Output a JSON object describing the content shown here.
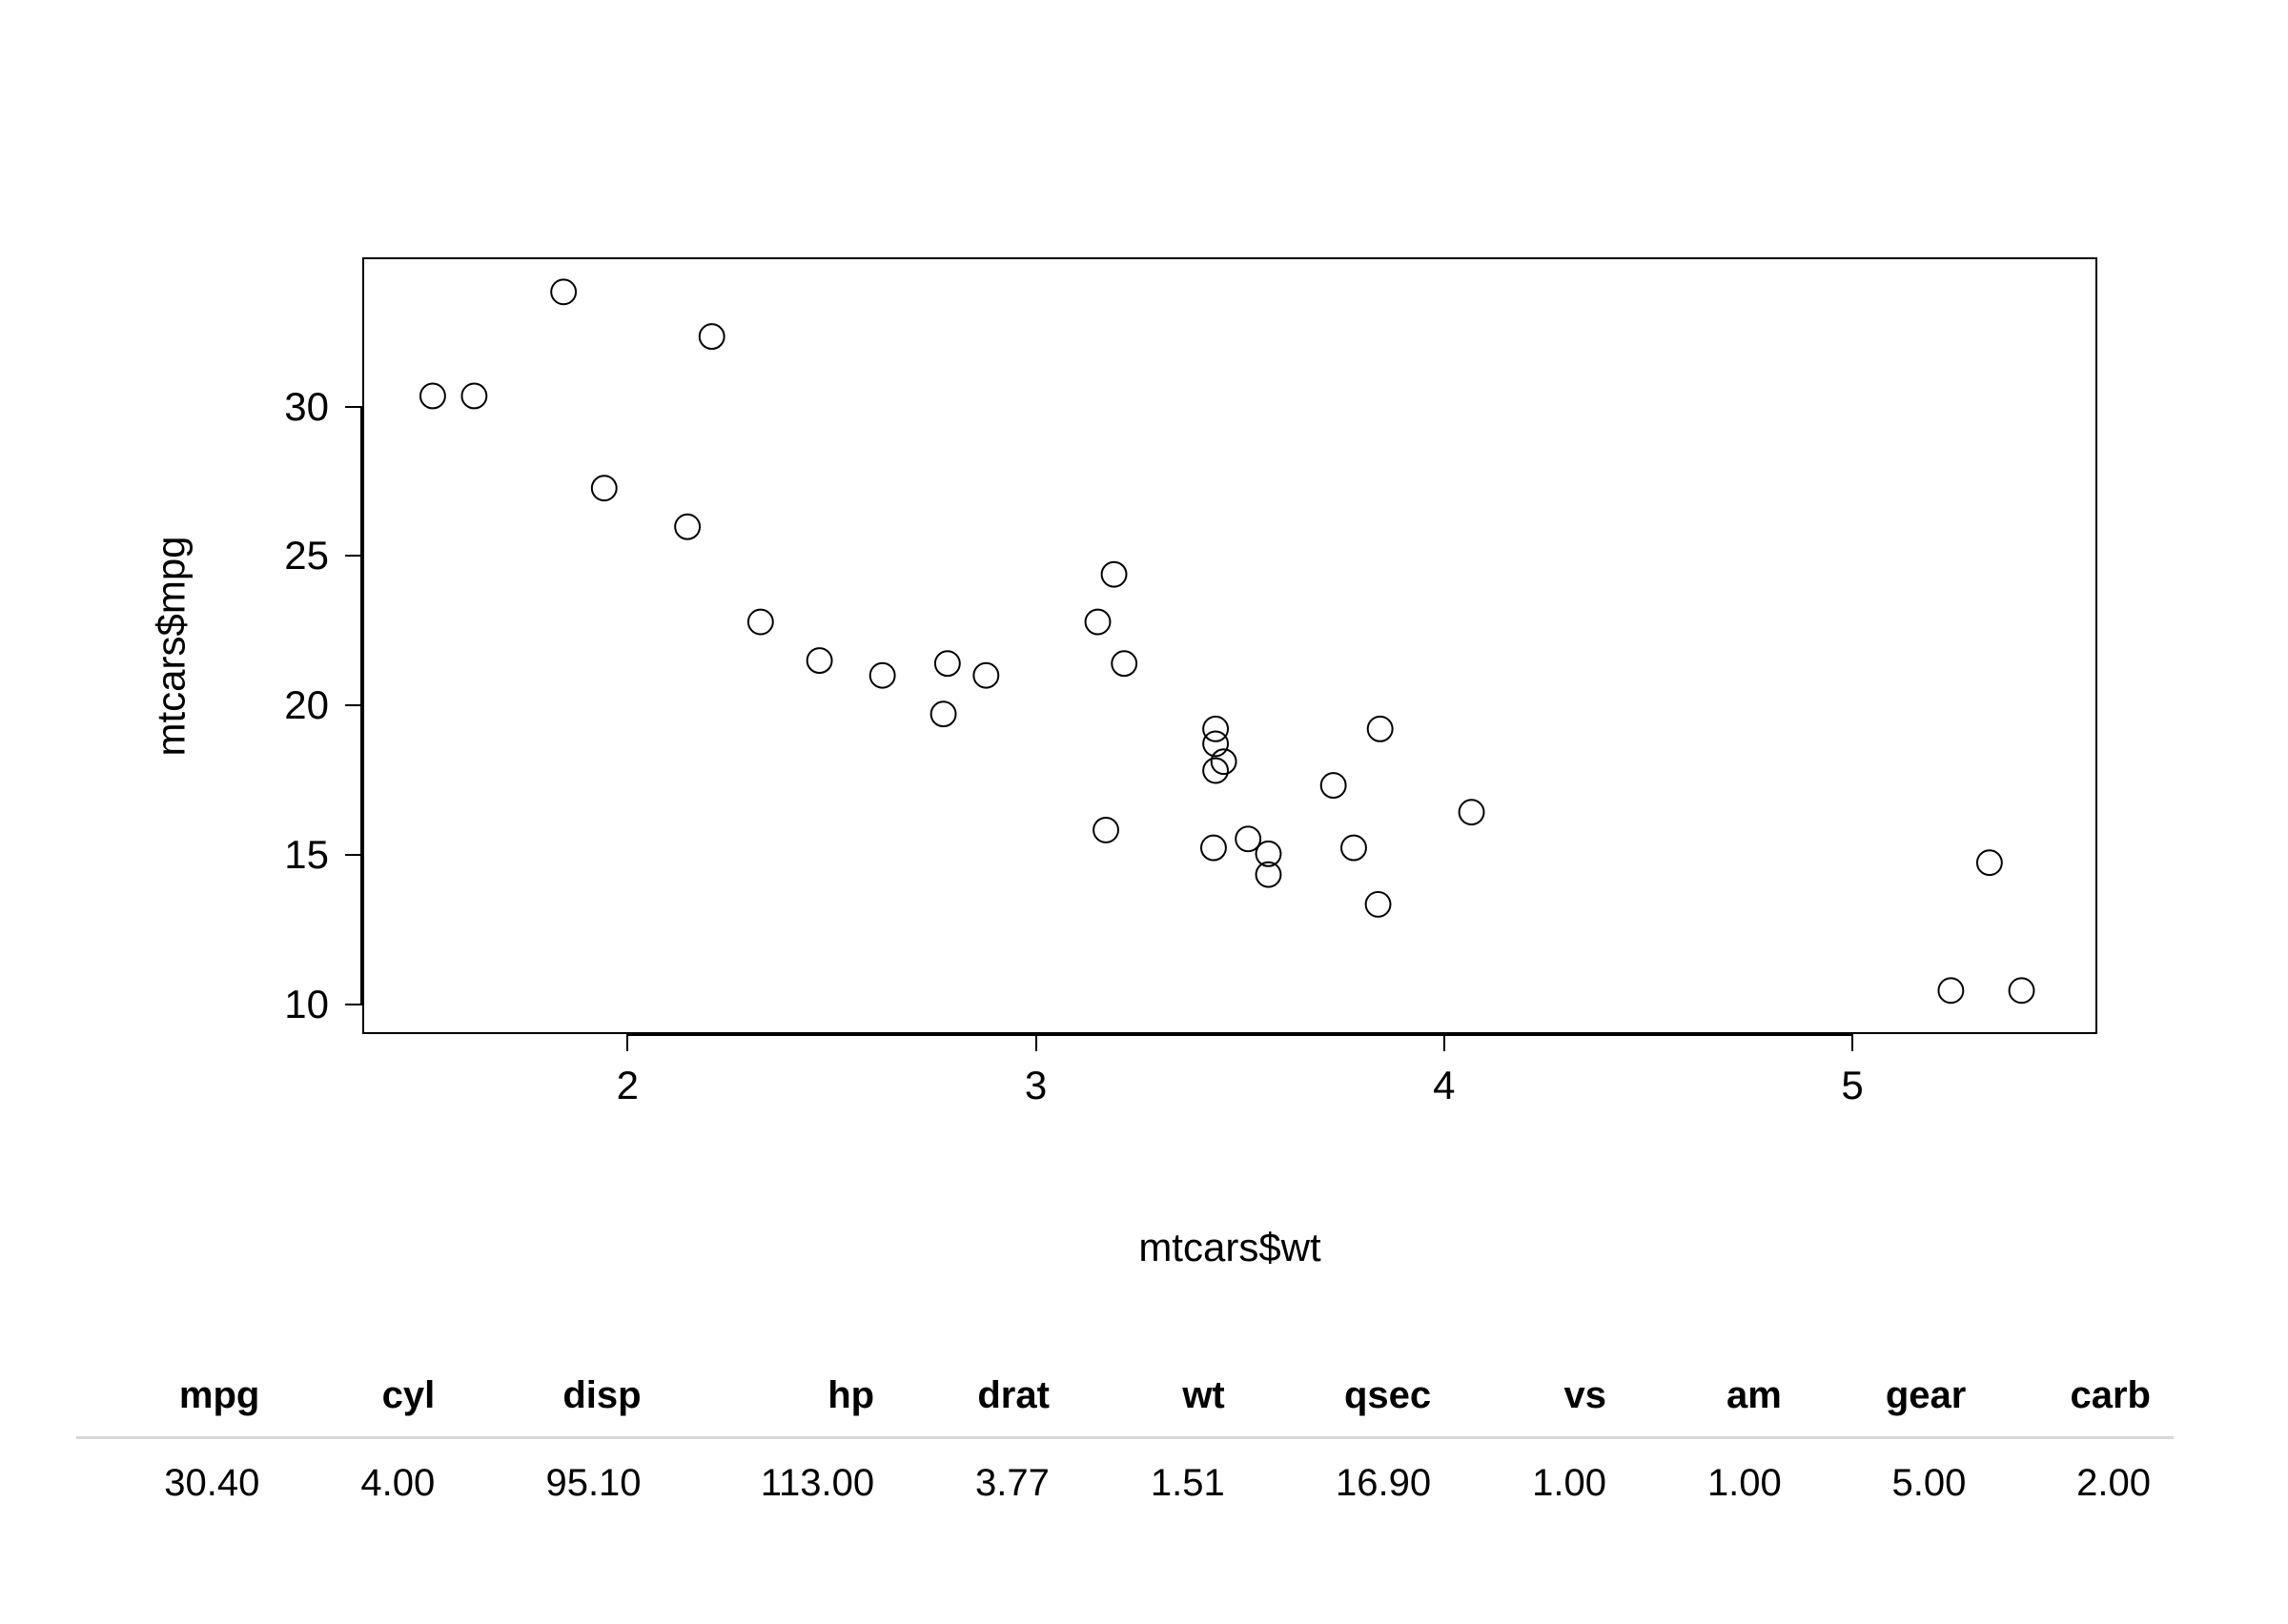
{
  "chart_data": {
    "type": "scatter",
    "xlabel": "mtcars$wt",
    "ylabel": "mtcars$mpg",
    "xlim": [
      1.35,
      5.6
    ],
    "ylim": [
      9.0,
      35.0
    ],
    "x_ticks": [
      2,
      3,
      4,
      5
    ],
    "y_ticks": [
      10,
      15,
      20,
      25,
      30
    ],
    "points": [
      {
        "x": 2.62,
        "y": 21.0
      },
      {
        "x": 2.875,
        "y": 21.0
      },
      {
        "x": 2.32,
        "y": 22.8
      },
      {
        "x": 3.215,
        "y": 21.4
      },
      {
        "x": 3.44,
        "y": 18.7
      },
      {
        "x": 3.46,
        "y": 18.1
      },
      {
        "x": 3.57,
        "y": 14.3
      },
      {
        "x": 3.19,
        "y": 24.4
      },
      {
        "x": 3.15,
        "y": 22.8
      },
      {
        "x": 3.44,
        "y": 19.2
      },
      {
        "x": 3.44,
        "y": 17.8
      },
      {
        "x": 4.07,
        "y": 16.4
      },
      {
        "x": 3.73,
        "y": 17.3
      },
      {
        "x": 3.78,
        "y": 15.2
      },
      {
        "x": 5.25,
        "y": 10.4
      },
      {
        "x": 5.424,
        "y": 10.4
      },
      {
        "x": 5.345,
        "y": 14.7
      },
      {
        "x": 2.2,
        "y": 32.4
      },
      {
        "x": 1.615,
        "y": 30.4
      },
      {
        "x": 1.835,
        "y": 33.9
      },
      {
        "x": 2.465,
        "y": 21.5
      },
      {
        "x": 3.52,
        "y": 15.5
      },
      {
        "x": 3.435,
        "y": 15.2
      },
      {
        "x": 3.84,
        "y": 13.3
      },
      {
        "x": 3.845,
        "y": 19.2
      },
      {
        "x": 1.935,
        "y": 27.3
      },
      {
        "x": 2.14,
        "y": 26.0
      },
      {
        "x": 1.513,
        "y": 30.4
      },
      {
        "x": 3.17,
        "y": 15.8
      },
      {
        "x": 2.77,
        "y": 19.7
      },
      {
        "x": 3.57,
        "y": 15.0
      },
      {
        "x": 2.78,
        "y": 21.4
      }
    ]
  },
  "table": {
    "headers": [
      "mpg",
      "cyl",
      "disp",
      "hp",
      "drat",
      "wt",
      "qsec",
      "vs",
      "am",
      "gear",
      "carb"
    ],
    "rows": [
      [
        "30.40",
        "4.00",
        "95.10",
        "113.00",
        "3.77",
        "1.51",
        "16.90",
        "1.00",
        "1.00",
        "5.00",
        "2.00"
      ]
    ]
  }
}
